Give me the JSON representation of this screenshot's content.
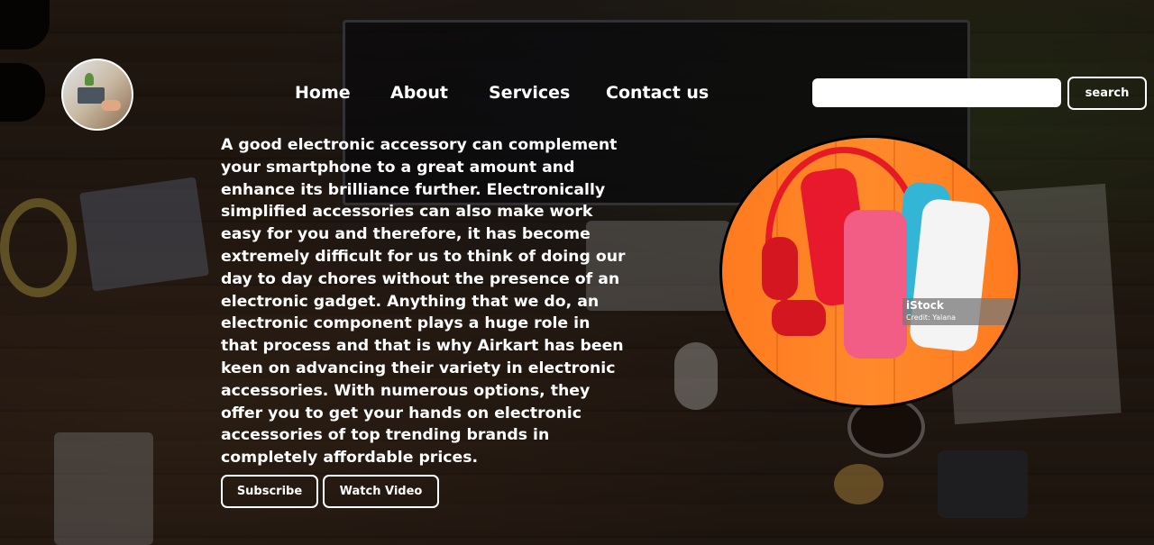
{
  "nav": {
    "items": [
      {
        "label": "Home"
      },
      {
        "label": "About"
      },
      {
        "label": "Services"
      },
      {
        "label": "Contact us"
      }
    ]
  },
  "search": {
    "value": "",
    "placeholder": "",
    "button_label": "search"
  },
  "hero": {
    "description": "A good electronic accessory can complement your smartphone to a great amount and enhance its brilliance further. Electronically simplified accessories can also make work easy for you and therefore, it has become extremely difficult for us to think of doing our day to day chores without the presence of an electronic gadget. Anything that we do, an electronic component plays a huge role in that process and that is why Airkart has been keen on advancing their variety in electronic accessories. With numerous options, they offer you to get your hands on electronic accessories of top trending brands in completely affordable prices.",
    "subscribe_label": "Subscribe",
    "watch_video_label": "Watch Video",
    "image_watermark": "iStock",
    "image_credit": "Credit: Yalana"
  },
  "colors": {
    "image_background": "#ff7a1f",
    "button_border": "#ffffff"
  }
}
